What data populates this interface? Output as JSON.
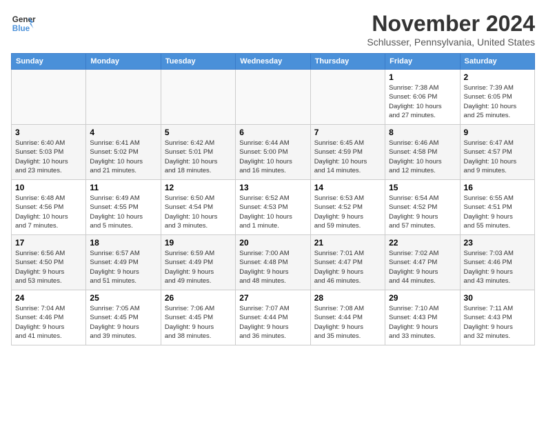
{
  "logo": {
    "line1": "General",
    "line2": "Blue"
  },
  "title": "November 2024",
  "location": "Schlusser, Pennsylvania, United States",
  "days_of_week": [
    "Sunday",
    "Monday",
    "Tuesday",
    "Wednesday",
    "Thursday",
    "Friday",
    "Saturday"
  ],
  "weeks": [
    [
      {
        "day": "",
        "info": ""
      },
      {
        "day": "",
        "info": ""
      },
      {
        "day": "",
        "info": ""
      },
      {
        "day": "",
        "info": ""
      },
      {
        "day": "",
        "info": ""
      },
      {
        "day": "1",
        "info": "Sunrise: 7:38 AM\nSunset: 6:06 PM\nDaylight: 10 hours\nand 27 minutes."
      },
      {
        "day": "2",
        "info": "Sunrise: 7:39 AM\nSunset: 6:05 PM\nDaylight: 10 hours\nand 25 minutes."
      }
    ],
    [
      {
        "day": "3",
        "info": "Sunrise: 6:40 AM\nSunset: 5:03 PM\nDaylight: 10 hours\nand 23 minutes."
      },
      {
        "day": "4",
        "info": "Sunrise: 6:41 AM\nSunset: 5:02 PM\nDaylight: 10 hours\nand 21 minutes."
      },
      {
        "day": "5",
        "info": "Sunrise: 6:42 AM\nSunset: 5:01 PM\nDaylight: 10 hours\nand 18 minutes."
      },
      {
        "day": "6",
        "info": "Sunrise: 6:44 AM\nSunset: 5:00 PM\nDaylight: 10 hours\nand 16 minutes."
      },
      {
        "day": "7",
        "info": "Sunrise: 6:45 AM\nSunset: 4:59 PM\nDaylight: 10 hours\nand 14 minutes."
      },
      {
        "day": "8",
        "info": "Sunrise: 6:46 AM\nSunset: 4:58 PM\nDaylight: 10 hours\nand 12 minutes."
      },
      {
        "day": "9",
        "info": "Sunrise: 6:47 AM\nSunset: 4:57 PM\nDaylight: 10 hours\nand 9 minutes."
      }
    ],
    [
      {
        "day": "10",
        "info": "Sunrise: 6:48 AM\nSunset: 4:56 PM\nDaylight: 10 hours\nand 7 minutes."
      },
      {
        "day": "11",
        "info": "Sunrise: 6:49 AM\nSunset: 4:55 PM\nDaylight: 10 hours\nand 5 minutes."
      },
      {
        "day": "12",
        "info": "Sunrise: 6:50 AM\nSunset: 4:54 PM\nDaylight: 10 hours\nand 3 minutes."
      },
      {
        "day": "13",
        "info": "Sunrise: 6:52 AM\nSunset: 4:53 PM\nDaylight: 10 hours\nand 1 minute."
      },
      {
        "day": "14",
        "info": "Sunrise: 6:53 AM\nSunset: 4:52 PM\nDaylight: 9 hours\nand 59 minutes."
      },
      {
        "day": "15",
        "info": "Sunrise: 6:54 AM\nSunset: 4:52 PM\nDaylight: 9 hours\nand 57 minutes."
      },
      {
        "day": "16",
        "info": "Sunrise: 6:55 AM\nSunset: 4:51 PM\nDaylight: 9 hours\nand 55 minutes."
      }
    ],
    [
      {
        "day": "17",
        "info": "Sunrise: 6:56 AM\nSunset: 4:50 PM\nDaylight: 9 hours\nand 53 minutes."
      },
      {
        "day": "18",
        "info": "Sunrise: 6:57 AM\nSunset: 4:49 PM\nDaylight: 9 hours\nand 51 minutes."
      },
      {
        "day": "19",
        "info": "Sunrise: 6:59 AM\nSunset: 4:49 PM\nDaylight: 9 hours\nand 49 minutes."
      },
      {
        "day": "20",
        "info": "Sunrise: 7:00 AM\nSunset: 4:48 PM\nDaylight: 9 hours\nand 48 minutes."
      },
      {
        "day": "21",
        "info": "Sunrise: 7:01 AM\nSunset: 4:47 PM\nDaylight: 9 hours\nand 46 minutes."
      },
      {
        "day": "22",
        "info": "Sunrise: 7:02 AM\nSunset: 4:47 PM\nDaylight: 9 hours\nand 44 minutes."
      },
      {
        "day": "23",
        "info": "Sunrise: 7:03 AM\nSunset: 4:46 PM\nDaylight: 9 hours\nand 43 minutes."
      }
    ],
    [
      {
        "day": "24",
        "info": "Sunrise: 7:04 AM\nSunset: 4:46 PM\nDaylight: 9 hours\nand 41 minutes."
      },
      {
        "day": "25",
        "info": "Sunrise: 7:05 AM\nSunset: 4:45 PM\nDaylight: 9 hours\nand 39 minutes."
      },
      {
        "day": "26",
        "info": "Sunrise: 7:06 AM\nSunset: 4:45 PM\nDaylight: 9 hours\nand 38 minutes."
      },
      {
        "day": "27",
        "info": "Sunrise: 7:07 AM\nSunset: 4:44 PM\nDaylight: 9 hours\nand 36 minutes."
      },
      {
        "day": "28",
        "info": "Sunrise: 7:08 AM\nSunset: 4:44 PM\nDaylight: 9 hours\nand 35 minutes."
      },
      {
        "day": "29",
        "info": "Sunrise: 7:10 AM\nSunset: 4:43 PM\nDaylight: 9 hours\nand 33 minutes."
      },
      {
        "day": "30",
        "info": "Sunrise: 7:11 AM\nSunset: 4:43 PM\nDaylight: 9 hours\nand 32 minutes."
      }
    ]
  ]
}
